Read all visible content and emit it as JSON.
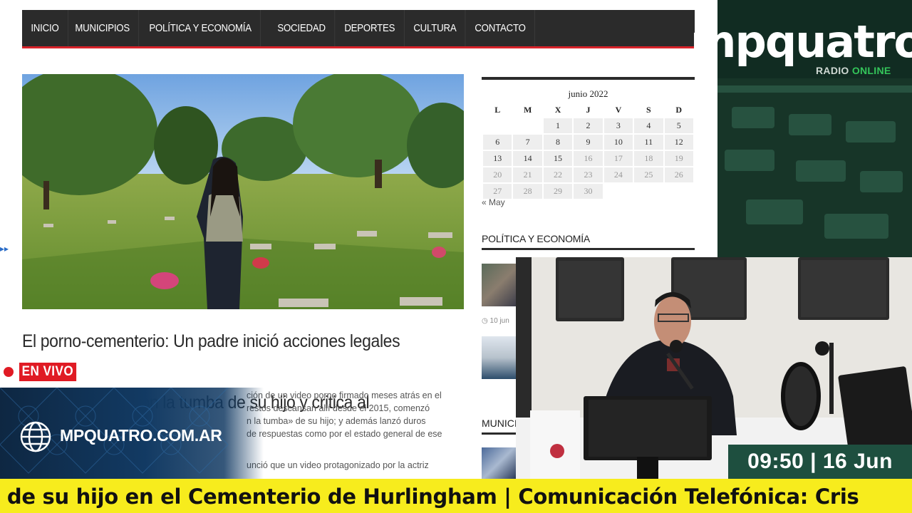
{
  "nav": {
    "items": [
      "INICIO",
      "MUNICIPIOS",
      "POLÍTICA Y ECONOMÍA",
      "SOCIEDAD",
      "DEPORTES",
      "CULTURA",
      "CONTACTO"
    ]
  },
  "article": {
    "headline_line1": "El porno-cementerio: Un padre inició acciones legales contra",
    "headline_line2": "profanaron la tumba de su hijo y critica al municipio",
    "body_lines": [
      "ción de un video porno firmado meses atrás en el",
      "restos descansan allí desde el 2015, comenzó",
      "n la tumba» de su hijo; y además lanzó duros",
      "de respuestas como por el estado general de ese",
      "unció que un video protagonizado por la actriz"
    ]
  },
  "calendar": {
    "title": "junio 2022",
    "weekdays": [
      "L",
      "M",
      "X",
      "J",
      "V",
      "S",
      "D"
    ],
    "weeks": [
      [
        "",
        "",
        "1",
        "2",
        "3",
        "4",
        "5"
      ],
      [
        "6",
        "7",
        "8",
        "9",
        "10",
        "11",
        "12"
      ],
      [
        "13",
        "14",
        "15",
        "16",
        "17",
        "18",
        "19"
      ],
      [
        "20",
        "21",
        "22",
        "23",
        "24",
        "25",
        "26"
      ],
      [
        "27",
        "28",
        "29",
        "30",
        "",
        "",
        ""
      ]
    ],
    "last_active_day": 15,
    "prev_link": "« May"
  },
  "sidebar": {
    "section_politica": "POLÍTICA Y ECONOMÍA",
    "thumb_date": "10 jun",
    "section_municipios": "MUNICIPIOS"
  },
  "broadcast": {
    "live_label": "EN VIVO",
    "site_url": "MPQUATRO.COM.AR",
    "logo": "mpquatro",
    "logo_sub_plain": "RADIO ",
    "logo_sub_accent": "ONLINE",
    "clock": "09:50 | 16 Jun",
    "ticker": "nba de su hijo en el Cementerio de Hurlingham | Comunicación Telefónica: Cris"
  },
  "colors": {
    "nav_bg": "#2b2b2b",
    "nav_accent": "#d8232a",
    "live_red": "#e01b24",
    "ticker_yellow": "#f7ec1d",
    "clock_green": "#1e4f3f",
    "brand_green": "#34c55a"
  }
}
